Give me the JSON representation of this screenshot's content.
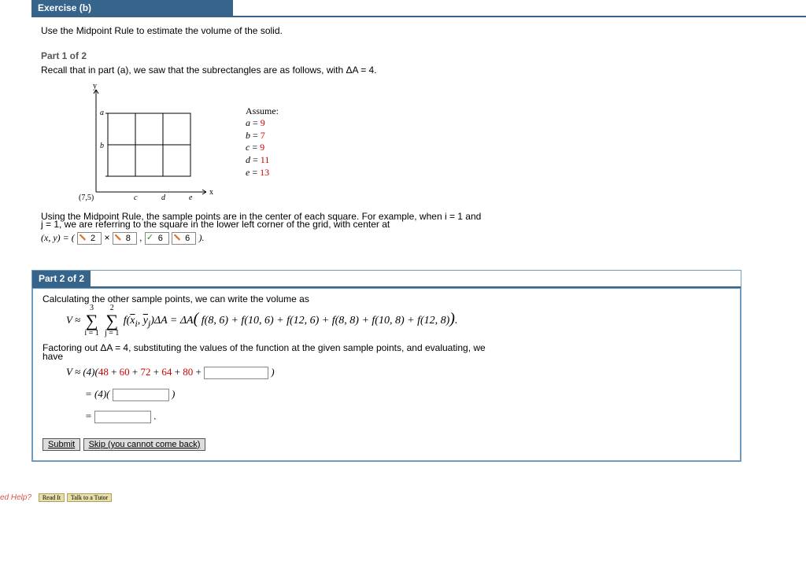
{
  "exercise": {
    "header": "Exercise (b)",
    "prompt": "Use the Midpoint Rule to estimate the volume of the solid."
  },
  "part1": {
    "header": "Part 1 of 2",
    "recall": "Recall that in part (a), we saw that the subrectangles are as follows, with ΔA = 4.",
    "origin_label": "(7,5)",
    "axis_y": "y",
    "axis_x": "x",
    "label_a": "a",
    "label_b": "b",
    "label_c": "c",
    "label_d": "d",
    "label_e": "e",
    "assume_title": "Assume:",
    "assume": {
      "a": {
        "name": "a",
        "val": "9"
      },
      "b": {
        "name": "b",
        "val": "7"
      },
      "c": {
        "name": "c",
        "val": "9"
      },
      "d": {
        "name": "d",
        "val": "11"
      },
      "e": {
        "name": "e",
        "val": "13"
      }
    },
    "midpoint_line1": "Using the Midpoint Rule, the sample points are in the center of each square. For example, when i = 1 and",
    "midpoint_line2": "j = 1, we are referring to the square in the lower left corner of the grid, with center at",
    "xy_open": "(x, y) = (",
    "input1": "2",
    "times": "×",
    "input2": "8",
    "comma": ",",
    "input3": "6",
    "input4": "6",
    "xy_close": ")."
  },
  "part2": {
    "header": "Part 2 of 2",
    "intro": "Calculating the other sample points, we can write the volume as",
    "v_approx": "V ≈ ",
    "sum1_top": "3",
    "sum1_bot": "i = 1",
    "sum2_top": "2",
    "sum2_bot": "j = 1",
    "sum_expr": " f(x̄ᵢ, ȳⱼ)ΔA = ΔA( f(8, 6) + f(10, 6) + f(12, 6) + f(8, 8) + f(10, 8) + f(12, 8) ).",
    "factor_line1": "Factoring out ΔA = 4, substituting the values of the function at the given sample points, and evaluating, we",
    "factor_line2": "have",
    "eval1_open": "V ≈ (4)(",
    "t1": "48",
    "t2": "60",
    "t3": "72",
    "t4": "64",
    "t5": "80",
    "plus": " + ",
    "eval1_close": ")",
    "eval2_open": "= (4)(",
    "eval2_close": ")",
    "eval3_open": "= ",
    "eval3_close": ".",
    "submit": "Submit",
    "skip": "Skip (you cannot come back)"
  },
  "help": {
    "label": "ed Help?",
    "read": "Read It",
    "tutor": "Talk to a Tutor"
  }
}
